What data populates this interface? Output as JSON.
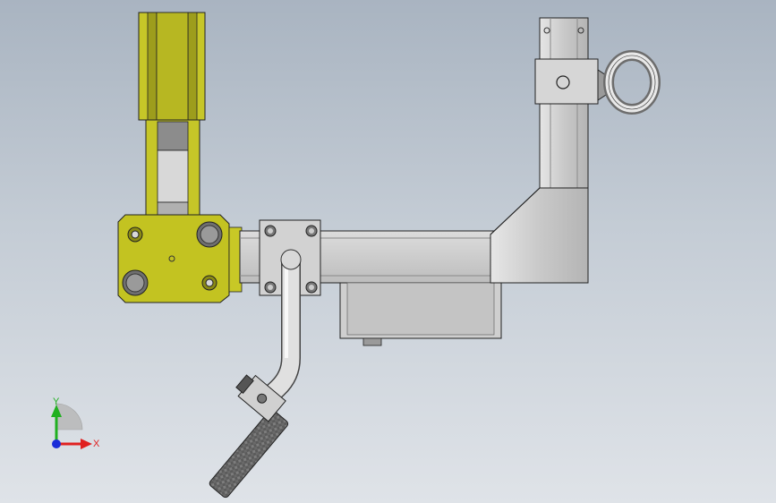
{
  "triad": {
    "y_label": "Y",
    "x_label": "X",
    "y_color": "#20b020",
    "x_color": "#e02020",
    "z_color": "#1a2cd8"
  },
  "colors": {
    "yellow_part": "#c3c321",
    "yellow_dark": "#8f8f14",
    "steel": "#c8c8c8",
    "steel_dark": "#9a9a9a",
    "edge": "#2a2a2a"
  },
  "parts": [
    {
      "name": "yellow-hinge-bracket"
    },
    {
      "name": "yellow-mount-plate"
    },
    {
      "name": "square-tube-arm"
    },
    {
      "name": "vertical-post"
    },
    {
      "name": "lifting-eye-bolt"
    },
    {
      "name": "bent-round-tube"
    },
    {
      "name": "carbon-grip-handle"
    },
    {
      "name": "under-arm-housing"
    }
  ]
}
